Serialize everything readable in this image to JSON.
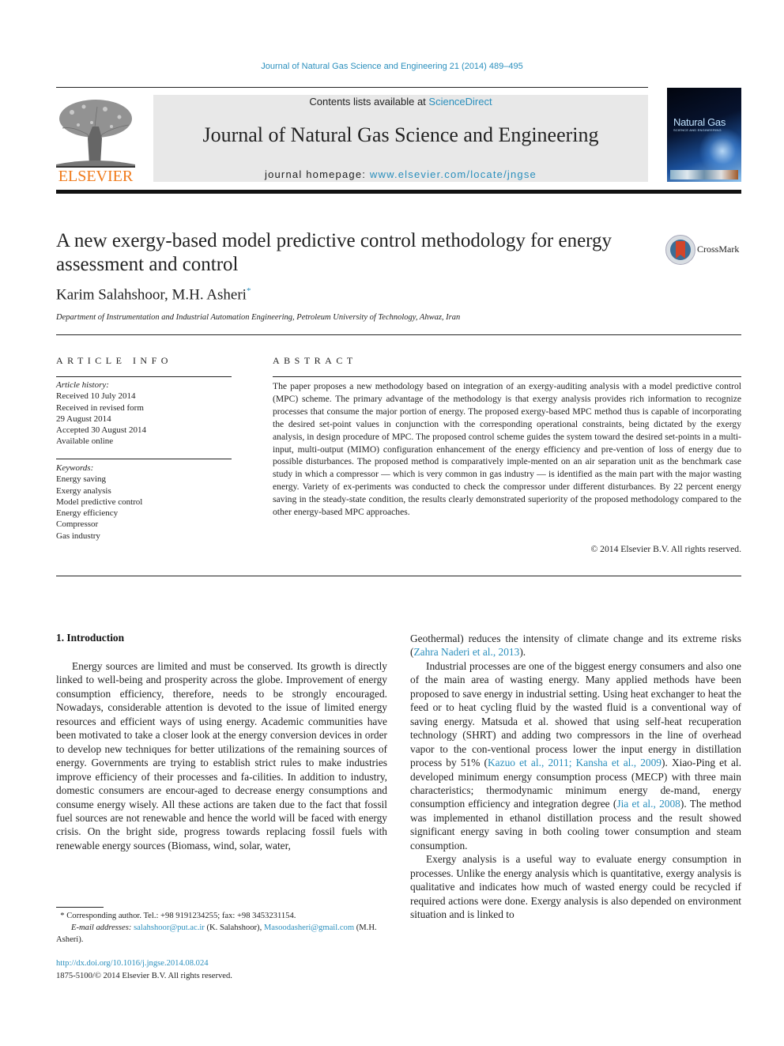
{
  "journal_reference": "Journal of Natural Gas Science and Engineering 21 (2014) 489–495",
  "publisher": {
    "name": "ELSEVIER",
    "logo_icon": "elsevier-tree-logo",
    "brand_color": "#f07a1a"
  },
  "header": {
    "contents_prefix": "Contents lists available at ",
    "contents_link": "ScienceDirect",
    "journal_title": "Journal of Natural Gas Science and Engineering",
    "homepage_prefix": "journal homepage: ",
    "homepage_link": "www.elsevier.com/locate/jngse",
    "link_color": "#2a8fbd",
    "banner_color": "#e8e8e8"
  },
  "cover": {
    "title": "Natural Gas",
    "subtitle": "SCIENCE AND ENGINEERING"
  },
  "crossmark": {
    "label": "CrossMark",
    "icon": "crossmark-icon"
  },
  "article": {
    "title_line1": "A new exergy-based model predictive control methodology for energy",
    "title_line2": "assessment and control",
    "authors": "Karim Salahshoor, M.H. Asheri",
    "author_mark": "*",
    "affiliation": "Department of Instrumentation and Industrial Automation Engineering, Petroleum University of Technology, Ahwaz, Iran"
  },
  "article_info": {
    "heading": "ARTICLE INFO",
    "history_label": "Article history:",
    "history": [
      "Received 10 July 2014",
      "Received in revised form",
      "29 August 2014",
      "Accepted 30 August 2014",
      "Available online"
    ],
    "keywords_label": "Keywords:",
    "keywords": [
      "Energy saving",
      "Exergy analysis",
      "Model predictive control",
      "Energy efficiency",
      "Compressor",
      "Gas industry"
    ]
  },
  "abstract": {
    "heading": "ABSTRACT",
    "text": "The paper proposes a new methodology based on integration of an exergy-auditing analysis with a model predictive control (MPC) scheme. The primary advantage of the methodology is that exergy analysis provides rich information to recognize processes that consume the major portion of energy. The proposed exergy-based MPC method thus is capable of incorporating the desired set-point values in conjunction with the corresponding operational constraints, being dictated by the exergy analysis, in design procedure of MPC. The proposed control scheme guides the system toward the desired set-points in a multi-input, multi-output (MIMO) configuration enhancement of the energy efficiency and pre-vention of loss of energy due to possible disturbances. The proposed method is comparatively imple-mented on an air separation unit as the benchmark case study in which a compressor — which is very common in gas industry — is identified as the main part with the major wasting energy. Variety of ex-periments was conducted to check the compressor under different disturbances. By 22 percent energy saving in the steady-state condition, the results clearly demonstrated superiority of the proposed methodology compared to the other energy-based MPC approaches.",
    "copyright": "© 2014 Elsevier B.V. All rights reserved."
  },
  "introduction": {
    "heading": "1.  Introduction",
    "left_para1": "Energy sources are limited and must be conserved. Its growth is directly linked to well-being and prosperity across the globe. Improvement of energy consumption efficiency, therefore, needs to be strongly encouraged. Nowadays, considerable attention is devoted to the issue of limited energy resources and efficient ways of using energy. Academic communities have been motivated to take a closer look at the energy conversion devices in order to develop new techniques for better utilizations of the remaining sources of energy. Governments are trying to establish strict rules to make industries improve efficiency of their processes and fa-cilities. In addition to industry, domestic consumers are encour-aged to decrease energy consumptions and consume energy wisely. All these actions are taken due to the fact that fossil fuel sources are not renewable and hence the world will be faced with energy crisis. On the bright side, progress towards replacing fossil fuels with renewable energy sources (Biomass, wind, solar, water,",
    "right_cont_text": "Geothermal) reduces the intensity of climate change and its extreme risks (",
    "right_cont_cite": "Zahra Naderi et al., 2013",
    "right_cont_end": ").",
    "right_para2_a": "Industrial processes are one of the biggest energy consumers and also one of the main area of wasting energy. Many applied methods have been proposed to save energy in industrial setting. Using heat exchanger to heat the feed or to heat cycling fluid by the wasted fluid is a conventional way of saving energy. Matsuda et al. showed that using self-heat recuperation technology (SHRT) and adding two compressors in the line of overhead vapor to the con-ventional process lower the input energy in distillation process by 51% (",
    "right_para2_cite1": "Kazuo et al., 2011; Kansha et al., 2009",
    "right_para2_b": "). Xiao-Ping et al. developed minimum energy consumption process (MECP) with three main characteristics; thermodynamic minimum energy de-mand, energy consumption efficiency and integration degree (",
    "right_para2_cite2": "Jia et al., 2008",
    "right_para2_c": "). The method was implemented in ethanol distillation process and the result showed significant energy saving in both cooling tower consumption and steam consumption.",
    "right_para3": "Exergy analysis is a useful way to evaluate energy consumption in processes. Unlike the energy analysis which is quantitative, exergy analysis is qualitative and indicates how much of wasted energy could be recycled if required actions were done. Exergy analysis is also depended on environment situation and is linked to"
  },
  "footnote": {
    "mark": "*",
    "corresponding": " Corresponding author. Tel.: +98 9191234255; fax: +98 3453231154.",
    "email_label": "E-mail addresses: ",
    "email1": "salahshoor@put.ac.ir",
    "email1_name": " (K. Salahshoor), ",
    "email2": "Masoodasheri@gmail.com",
    "email2_name": " (M.H. Asheri)."
  },
  "doi": {
    "link": "http://dx.doi.org/10.1016/j.jngse.2014.08.024",
    "issn_copyright": "1875-5100/© 2014 Elsevier B.V. All rights reserved."
  }
}
